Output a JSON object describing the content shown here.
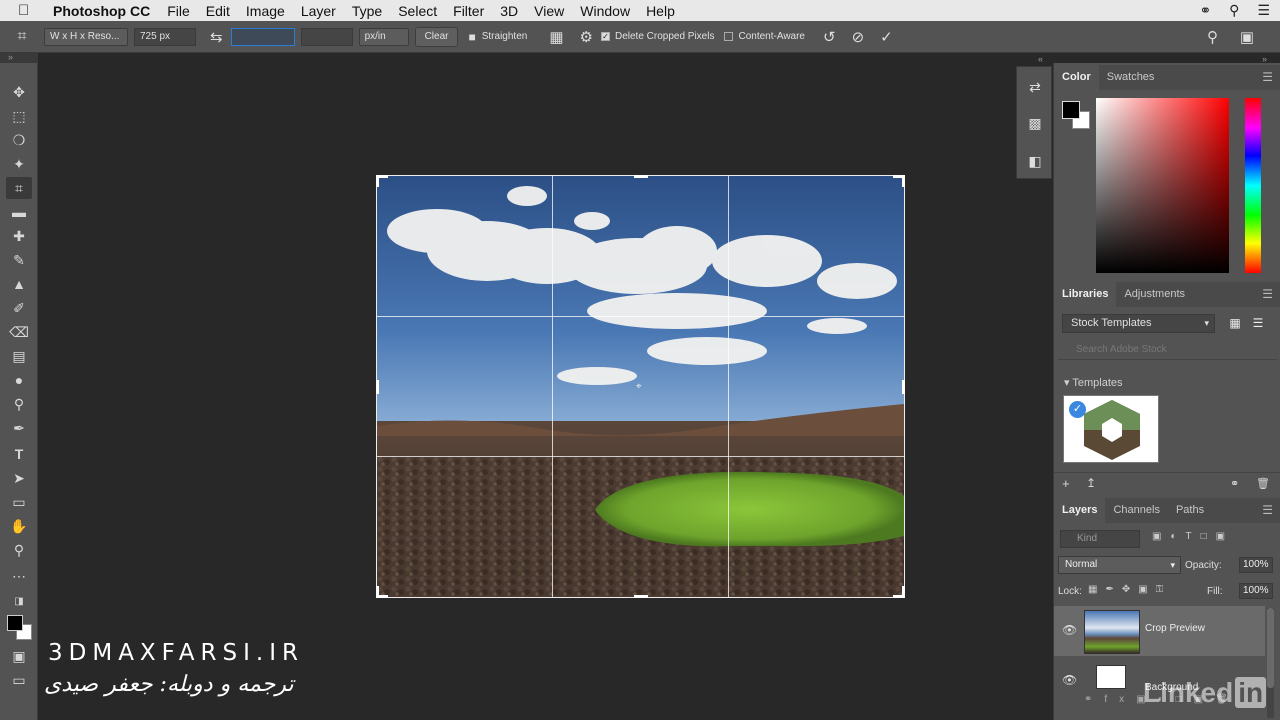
{
  "menubar": {
    "apple": "",
    "app": "Photoshop CC",
    "items": [
      "File",
      "Edit",
      "Image",
      "Layer",
      "Type",
      "Select",
      "Filter",
      "3D",
      "View",
      "Window",
      "Help"
    ]
  },
  "options": {
    "preset": "W x H x Reso...",
    "width": "725 px",
    "height": "",
    "resolution": "",
    "units": "px/in",
    "clear": "Clear",
    "straighten": "Straighten",
    "delete_cropped": "Delete Cropped Pixels",
    "content_aware": "Content-Aware"
  },
  "panels": {
    "color_tab": "Color",
    "swatches_tab": "Swatches",
    "libraries_tab": "Libraries",
    "adjustments_tab": "Adjustments",
    "library_select": "Stock Templates",
    "library_search_placeholder": "Search Adobe Stock",
    "templates_label": "Templates",
    "layers_tab": "Layers",
    "channels_tab": "Channels",
    "paths_tab": "Paths",
    "kind_placeholder": "Kind",
    "blend_mode": "Normal",
    "opacity_label": "Opacity:",
    "opacity_value": "100%",
    "lock_label": "Lock:",
    "fill_label": "Fill:",
    "fill_value": "100%",
    "layers": [
      {
        "name": "Crop Preview"
      },
      {
        "name": "Background"
      }
    ]
  },
  "watermark": {
    "site": "3DMAXFARSI.IR",
    "credit": "ترجمه و دوبله: جعفر صیدی",
    "linkedin_word": "Linked",
    "linkedin_in": "in"
  },
  "colors": {
    "fg": "#000000",
    "bg": "#ffffff",
    "accent": "#2d7cd6"
  }
}
